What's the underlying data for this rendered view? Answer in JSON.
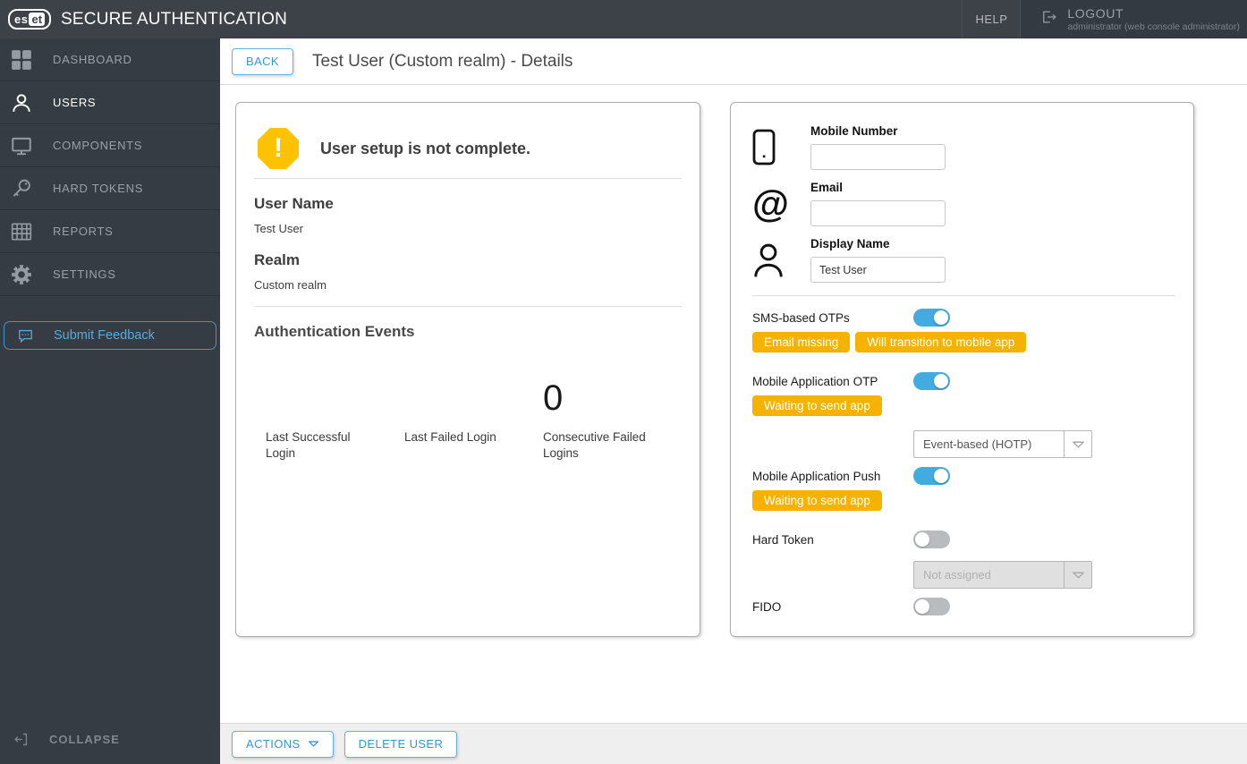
{
  "topbar": {
    "logo_es": "es",
    "logo_et": "et",
    "brand": "SECURE AUTHENTICATION",
    "help_label": "HELP",
    "logout_label": "LOGOUT",
    "logout_sub": "administrator (web console administrator)"
  },
  "sidebar": {
    "items": [
      {
        "label": "DASHBOARD",
        "icon": "dashboard-grid-icon",
        "active": false
      },
      {
        "label": "USERS",
        "icon": "user-icon",
        "active": true
      },
      {
        "label": "COMPONENTS",
        "icon": "monitor-icon",
        "active": false
      },
      {
        "label": "HARD TOKENS",
        "icon": "key-icon",
        "active": false
      },
      {
        "label": "REPORTS",
        "icon": "table-grid-icon",
        "active": false
      },
      {
        "label": "SETTINGS",
        "icon": "gear-icon",
        "active": false
      }
    ],
    "feedback_label": "Submit Feedback",
    "collapse_label": "COLLAPSE"
  },
  "header": {
    "back_label": "BACK",
    "title": "Test User (Custom realm) - Details"
  },
  "summary_card": {
    "warning_text": "User setup is not complete.",
    "fields": [
      {
        "label": "User Name",
        "value": "Test User"
      },
      {
        "label": "Realm",
        "value": "Custom realm"
      }
    ],
    "events": {
      "title": "Authentication Events",
      "stats": [
        {
          "label": "Last Successful Login",
          "value": ""
        },
        {
          "label": "Last Failed Login",
          "value": ""
        },
        {
          "label": "Consecutive Failed Logins",
          "value": "0"
        }
      ]
    }
  },
  "details_card": {
    "contact_fields": [
      {
        "label": "Mobile Number",
        "value": "",
        "icon": "phone-icon"
      },
      {
        "label": "Email",
        "value": "",
        "icon": "at-icon"
      },
      {
        "label": "Display Name",
        "value": "Test User",
        "icon": "person-icon"
      }
    ],
    "auth_methods": [
      {
        "label": "SMS-based OTPs",
        "enabled": true,
        "badges": [
          "Email missing",
          "Will transition to mobile app"
        ]
      },
      {
        "label": "Mobile Application OTP",
        "enabled": true,
        "badges": [
          "Waiting to send app"
        ],
        "select": {
          "value": "Event-based (HOTP)",
          "disabled": false
        }
      },
      {
        "label": "Mobile Application Push",
        "enabled": true,
        "badges": [
          "Waiting to send app"
        ]
      },
      {
        "label": "Hard Token",
        "enabled": false,
        "select": {
          "value": "Not assigned",
          "disabled": true
        }
      },
      {
        "label": "FIDO",
        "enabled": false
      }
    ]
  },
  "footer": {
    "actions_label": "ACTIONS",
    "delete_label": "DELETE USER"
  },
  "colors": {
    "topbar_bg": "#3d4249",
    "sidebar_bg": "#363c44",
    "accent_blue": "#42abe0",
    "button_blue": "#2e9ad3",
    "warning_yellow": "#fdc202",
    "badge_yellow": "#f5b300",
    "toggle_off_gray": "#b9bcbe"
  }
}
